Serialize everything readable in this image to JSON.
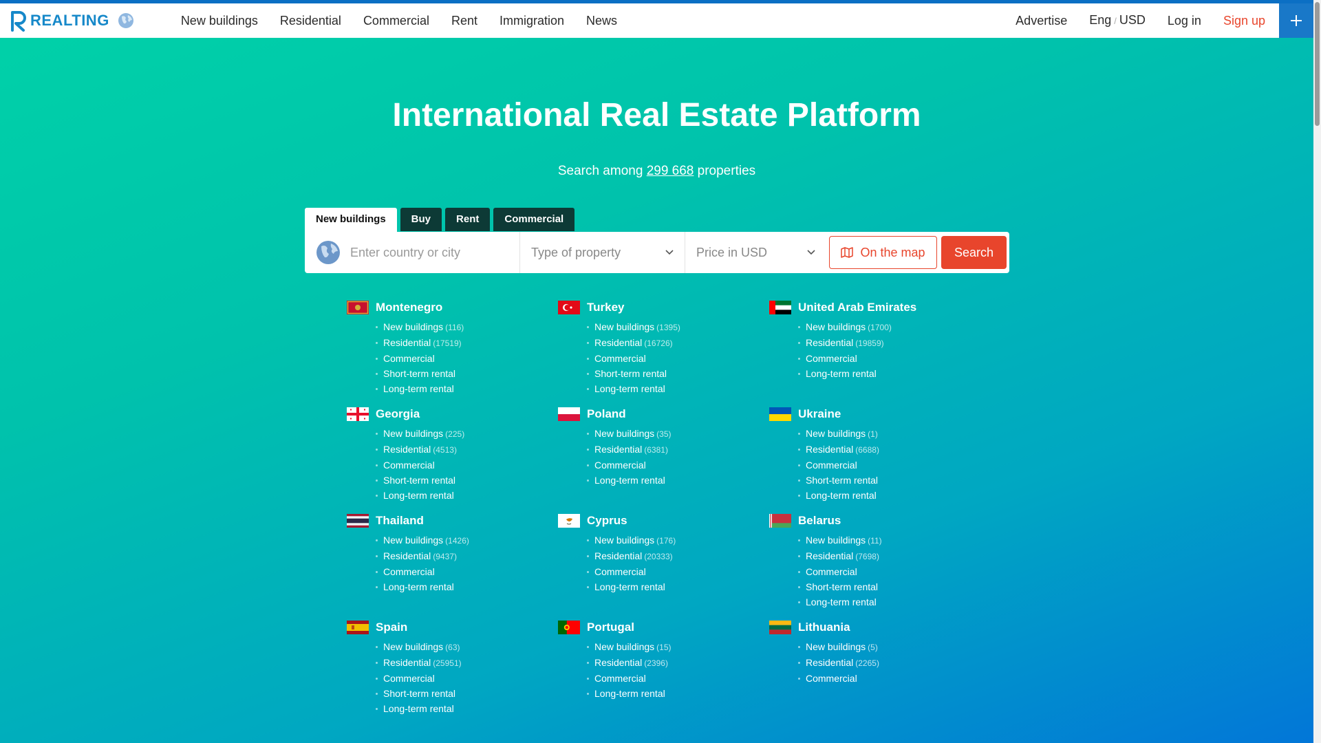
{
  "header": {
    "logo_text": "REALTING",
    "nav": [
      "New buildings",
      "Residential",
      "Commercial",
      "Rent",
      "Immigration",
      "News"
    ],
    "advertise": "Advertise",
    "lang": "Eng",
    "currency": "USD",
    "login": "Log in",
    "signup": "Sign up"
  },
  "hero": {
    "title": "International Real Estate Platform",
    "sub_prefix": "Search among",
    "sub_count": "299 668",
    "sub_suffix": "properties"
  },
  "tabs": [
    "New buildings",
    "Buy",
    "Rent",
    "Commercial"
  ],
  "search": {
    "location_placeholder": "Enter country or city",
    "type_placeholder": "Type of property",
    "price_placeholder": "Price in USD",
    "map_label": "On the map",
    "search_label": "Search"
  },
  "colors": {
    "accent": "#e8452c",
    "brand": "#1688c9",
    "tab_dark": "#0d3a36"
  },
  "countries": [
    {
      "name": "Montenegro",
      "flag": "montenegro",
      "links": [
        {
          "label": "New buildings",
          "count": "(116)"
        },
        {
          "label": "Residential",
          "count": "(17519)"
        },
        {
          "label": "Commercial",
          "count": ""
        },
        {
          "label": "Short-term rental",
          "count": ""
        },
        {
          "label": "Long-term rental",
          "count": ""
        }
      ]
    },
    {
      "name": "Turkey",
      "flag": "turkey",
      "links": [
        {
          "label": "New buildings",
          "count": "(1395)"
        },
        {
          "label": "Residential",
          "count": "(16726)"
        },
        {
          "label": "Commercial",
          "count": ""
        },
        {
          "label": "Short-term rental",
          "count": ""
        },
        {
          "label": "Long-term rental",
          "count": ""
        }
      ]
    },
    {
      "name": "United Arab Emirates",
      "flag": "uae",
      "links": [
        {
          "label": "New buildings",
          "count": "(1700)"
        },
        {
          "label": "Residential",
          "count": "(19859)"
        },
        {
          "label": "Commercial",
          "count": ""
        },
        {
          "label": "Long-term rental",
          "count": ""
        }
      ]
    },
    {
      "name": "Georgia",
      "flag": "georgia",
      "links": [
        {
          "label": "New buildings",
          "count": "(225)"
        },
        {
          "label": "Residential",
          "count": "(4513)"
        },
        {
          "label": "Commercial",
          "count": ""
        },
        {
          "label": "Short-term rental",
          "count": ""
        },
        {
          "label": "Long-term rental",
          "count": ""
        }
      ]
    },
    {
      "name": "Poland",
      "flag": "poland",
      "links": [
        {
          "label": "New buildings",
          "count": "(35)"
        },
        {
          "label": "Residential",
          "count": "(6381)"
        },
        {
          "label": "Commercial",
          "count": ""
        },
        {
          "label": "Long-term rental",
          "count": ""
        }
      ]
    },
    {
      "name": "Ukraine",
      "flag": "ukraine",
      "links": [
        {
          "label": "New buildings",
          "count": "(1)"
        },
        {
          "label": "Residential",
          "count": "(6688)"
        },
        {
          "label": "Commercial",
          "count": ""
        },
        {
          "label": "Short-term rental",
          "count": ""
        },
        {
          "label": "Long-term rental",
          "count": ""
        }
      ]
    },
    {
      "name": "Thailand",
      "flag": "thailand",
      "links": [
        {
          "label": "New buildings",
          "count": "(1426)"
        },
        {
          "label": "Residential",
          "count": "(9437)"
        },
        {
          "label": "Commercial",
          "count": ""
        },
        {
          "label": "Long-term rental",
          "count": ""
        }
      ]
    },
    {
      "name": "Cyprus",
      "flag": "cyprus",
      "links": [
        {
          "label": "New buildings",
          "count": "(176)"
        },
        {
          "label": "Residential",
          "count": "(20333)"
        },
        {
          "label": "Commercial",
          "count": ""
        },
        {
          "label": "Long-term rental",
          "count": ""
        }
      ]
    },
    {
      "name": "Belarus",
      "flag": "belarus",
      "links": [
        {
          "label": "New buildings",
          "count": "(11)"
        },
        {
          "label": "Residential",
          "count": "(7698)"
        },
        {
          "label": "Commercial",
          "count": ""
        },
        {
          "label": "Short-term rental",
          "count": ""
        },
        {
          "label": "Long-term rental",
          "count": ""
        }
      ]
    },
    {
      "name": "Spain",
      "flag": "spain",
      "links": [
        {
          "label": "New buildings",
          "count": "(63)"
        },
        {
          "label": "Residential",
          "count": "(25951)"
        },
        {
          "label": "Commercial",
          "count": ""
        },
        {
          "label": "Short-term rental",
          "count": ""
        },
        {
          "label": "Long-term rental",
          "count": ""
        }
      ]
    },
    {
      "name": "Portugal",
      "flag": "portugal",
      "links": [
        {
          "label": "New buildings",
          "count": "(15)"
        },
        {
          "label": "Residential",
          "count": "(2396)"
        },
        {
          "label": "Commercial",
          "count": ""
        },
        {
          "label": "Long-term rental",
          "count": ""
        }
      ]
    },
    {
      "name": "Lithuania",
      "flag": "lithuania",
      "links": [
        {
          "label": "New buildings",
          "count": "(5)"
        },
        {
          "label": "Residential",
          "count": "(2265)"
        },
        {
          "label": "Commercial",
          "count": ""
        }
      ]
    }
  ]
}
